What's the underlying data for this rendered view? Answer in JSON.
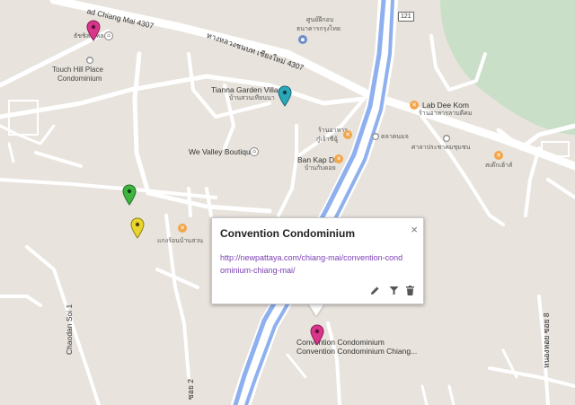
{
  "map": {
    "labels": {
      "road_chiang_mai_4307_top": "ad Chiang Mai 4307",
      "road_thai_4307": "ทางหลวงชนบท เชียงใหม่ 4307",
      "shield_121": "121",
      "touch_hill_thai": "ธัชชิลส์เพลส",
      "touch_hill_1": "Touch Hill Place",
      "touch_hill_2": "Condominium",
      "tianna_1": "Tianna Garden Village",
      "tianna_2": "บ้านสวนเทียนนา",
      "lab_dee_kom_1": "Lab Dee Kom",
      "lab_dee_kom_2": "ร้านอาหารลาบดีคม",
      "top_thai_1": "ศูนย์ฝึกอบ",
      "top_thai_2": "ธนาคารกรุงไทย",
      "we_valley": "We Valley Boutique",
      "ban_kap_doi_1": "Ban Kap Doi",
      "ban_kap_doi_2": "บ้านกับดอย",
      "kui_thai_1": "ร้านอาหาร",
      "kui_thai_2": "กู๋เจ้าชีฉู้",
      "right_thai_1": "ตลาดนมจ",
      "right_thai_2": "ศาลาประชาคมชุมชน",
      "right_thai_3": "สเต๊กเฮ้าส์",
      "left_thai": "แกงร้อนบ้านสวน",
      "chaodan": "Chaodan Soi 1",
      "soi_8": "หนองหอย ซอย 8",
      "soi_2": "ซอย 2",
      "convention_1": "Convention Condominium",
      "convention_2": "Convention Condominium Chiang..."
    }
  },
  "info_window": {
    "title": "Convention Condominium",
    "link": "http://newpattaya.com/chiang-mai/convention-condominium-chiang-mai/",
    "close_glyph": "×"
  },
  "colors": {
    "land": "#e8e3dc",
    "road": "#ffffff",
    "highway": "#8fb0ef",
    "park": "#c9dfc8",
    "marker_pink": "#d8358b",
    "marker_teal": "#2aa7b8",
    "marker_green": "#3fb53f",
    "marker_yellow": "#e8d62d"
  }
}
